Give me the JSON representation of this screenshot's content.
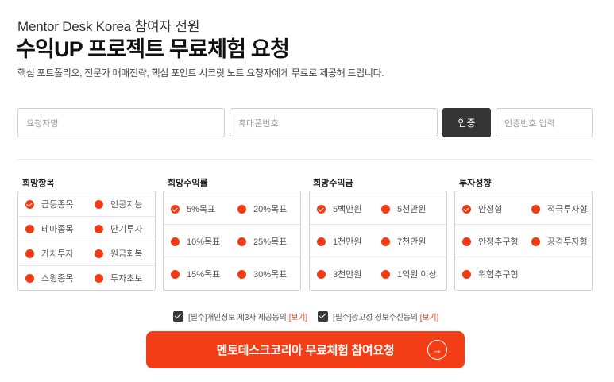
{
  "header": {
    "pretitle": "Mentor Desk Korea 참여자 전원",
    "title": "수익UP 프로젝트 무료체험 요청",
    "description": "핵심 포트폴리오, 전문가 매매전략, 핵심 포인트 시크릿 노트 요청자에게 무료로 제공해 드립니다."
  },
  "form": {
    "name_placeholder": "요청자명",
    "phone_placeholder": "휴대폰번호",
    "verify_label": "인증",
    "code_placeholder": "인증번호 입력"
  },
  "groups": [
    {
      "title": "희망항목",
      "options": [
        {
          "label": "급등종목",
          "checked": true
        },
        {
          "label": "인공지능",
          "checked": false
        },
        {
          "label": "테마종목",
          "checked": false
        },
        {
          "label": "단기투자",
          "checked": false
        },
        {
          "label": "가치투자",
          "checked": false
        },
        {
          "label": "원금회복",
          "checked": false
        },
        {
          "label": "스윙종목",
          "checked": false
        },
        {
          "label": "투자초보",
          "checked": false
        }
      ]
    },
    {
      "title": "희망수익률",
      "options": [
        {
          "label": "5%목표",
          "checked": true
        },
        {
          "label": "20%목표",
          "checked": false
        },
        {
          "label": "10%목표",
          "checked": false
        },
        {
          "label": "25%목표",
          "checked": false
        },
        {
          "label": "15%목표",
          "checked": false
        },
        {
          "label": "30%목표",
          "checked": false
        }
      ]
    },
    {
      "title": "희망수익금",
      "options": [
        {
          "label": "5백만원",
          "checked": true
        },
        {
          "label": "5천만원",
          "checked": false
        },
        {
          "label": "1천만원",
          "checked": false
        },
        {
          "label": "7천만원",
          "checked": false
        },
        {
          "label": "3천만원",
          "checked": false
        },
        {
          "label": "1억원 이상",
          "checked": false
        }
      ]
    },
    {
      "title": "투자성향",
      "options": [
        {
          "label": "안정형",
          "checked": true
        },
        {
          "label": "적극투자형",
          "checked": false
        },
        {
          "label": "안정추구형",
          "checked": false
        },
        {
          "label": "공격투자형",
          "checked": false
        },
        {
          "label": "위험추구형",
          "checked": false
        }
      ]
    }
  ],
  "agreements": [
    {
      "label": "[필수]개인정보 제3자 제공동의",
      "link": "[보기]",
      "checked": true
    },
    {
      "label": "[필수]광고성 정보수신동의",
      "link": "[보기]",
      "checked": true
    }
  ],
  "cta": {
    "label": "멘토데스크코리아 무료체험 참여요청",
    "icon": "arrow-right-circle-icon"
  },
  "colors": {
    "accent": "#f23d16",
    "dark_button": "#353535"
  }
}
